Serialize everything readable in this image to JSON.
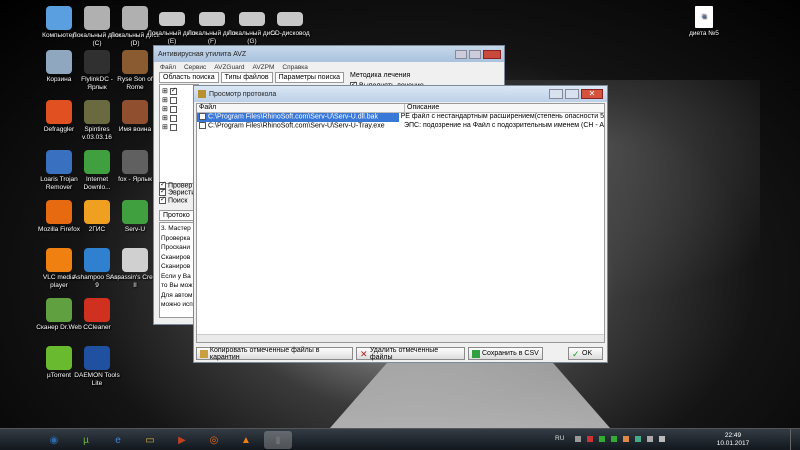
{
  "desktop": {
    "icons_col1": [
      {
        "label": "Компьютер",
        "icon": "computer-icon",
        "color": "#5aa0e0"
      },
      {
        "label": "Корзина",
        "icon": "recycle-bin-icon",
        "color": "#8fa8c0"
      },
      {
        "label": "Defraggler",
        "icon": "defraggler-icon",
        "color": "#e05020"
      },
      {
        "label": "Loaris Trojan Remover",
        "icon": "loaris-icon",
        "color": "#3a70c0"
      },
      {
        "label": "Mozilla Firefox",
        "icon": "firefox-icon",
        "color": "#e86a10"
      },
      {
        "label": "VLC media player",
        "icon": "vlc-icon",
        "color": "#f08010"
      },
      {
        "label": "Сканер Dr.Web",
        "icon": "drweb-icon",
        "color": "#60a040"
      },
      {
        "label": "µTorrent",
        "icon": "utorrent-icon",
        "color": "#6aba30"
      }
    ],
    "icons_col2": [
      {
        "label": "Локальный диск (C)",
        "icon": "drive-icon",
        "color": "#b0b0b0"
      },
      {
        "label": "FlylinkDC - Ярлык",
        "icon": "flylink-icon",
        "color": "#303030"
      },
      {
        "label": "Spintires v.03.03.16",
        "icon": "spintires-icon",
        "color": "#6a6a40"
      },
      {
        "label": "Internet Downlo...",
        "icon": "idm-icon",
        "color": "#40a040"
      },
      {
        "label": "2ГИС",
        "icon": "2gis-icon",
        "color": "#f0a020"
      },
      {
        "label": "Ashampoo Snap 9",
        "icon": "ashampoo-icon",
        "color": "#3080d0"
      },
      {
        "label": "CCleaner",
        "icon": "ccleaner-icon",
        "color": "#d03020"
      },
      {
        "label": "DAEMON Tools Lite",
        "icon": "daemon-icon",
        "color": "#2050a0"
      }
    ],
    "icons_col3": [
      {
        "label": "Локальный диск (D)",
        "icon": "drive-icon",
        "color": "#b0b0b0"
      },
      {
        "label": "Ryse Son of Rome",
        "icon": "ryse-icon",
        "color": "#8a5a30"
      },
      {
        "label": "Имя воина",
        "icon": "game-icon",
        "color": "#905030"
      },
      {
        "label": "fox - Ярлык",
        "icon": "fox-icon",
        "color": "#606060"
      },
      {
        "label": "Serv-U",
        "icon": "servu-icon",
        "color": "#40a040"
      },
      {
        "label": "Assassin's Creed II",
        "icon": "assassin-icon",
        "color": "#d0d0d0"
      }
    ],
    "icons_top": [
      {
        "label": "Локальный диск (E)",
        "icon": "drive-icon"
      },
      {
        "label": "Локальный диск (F)",
        "icon": "drive-icon"
      },
      {
        "label": "Локальный диск (G)",
        "icon": "drive-icon"
      },
      {
        "label": "CD-дисковод",
        "icon": "cd-drive-icon"
      }
    ],
    "right_icon": {
      "label": "диета №5",
      "icon": "text-file-icon"
    }
  },
  "avz_window": {
    "title": "Антивирусная утилита AVZ",
    "menu": [
      "Файл",
      "Сервис",
      "AVZGuard",
      "AVZPM",
      "Справка"
    ],
    "tabs": [
      "Область поиска",
      "Типы файлов",
      "Параметры поиска"
    ],
    "right_label": "Методика лечения",
    "right_check": "Выполнять лечение",
    "checks": [
      "Провер",
      "Эвристи",
      "Поиск"
    ],
    "protocol_tab": "Протоко",
    "log_lines": [
      "3. Мастер",
      "Проверка",
      "Проскани",
      "Сканиров",
      "Сканиров",
      "Если у Ва",
      "то Вы мож",
      "Для автом",
      "можно исп"
    ]
  },
  "protocol_window": {
    "title": "Просмотр протокола",
    "col_file": "Файл",
    "col_desc": "Описание",
    "rows": [
      {
        "file": "C:\\Program Files\\RhinoSoft.com\\Serv-U\\Serv-U.dll.bak",
        "desc": "PE файл с нестандартным расширением(степень опасности 5"
      },
      {
        "file": "C:\\Program Files\\RhinoSoft.com\\Serv-U\\Serv-U-Tray.exe",
        "desc": "ЭПС: подозрение на Файл с подозрительным именем (CH - A"
      }
    ],
    "btn_copy": "Копировать отмеченные файлы в карантин",
    "btn_delete": "Удалить отмеченные файлы",
    "btn_save": "Сохранить в CSV",
    "btn_ok": "OK"
  },
  "taskbar": {
    "time": "22:49",
    "date": "10.01.2017",
    "lang": "RU",
    "apps": [
      "start-orb-icon",
      "utorrent-icon",
      "ie-icon",
      "explorer-icon",
      "media-player-icon",
      "firefox-icon",
      "vlc-icon",
      "avz-icon"
    ]
  }
}
